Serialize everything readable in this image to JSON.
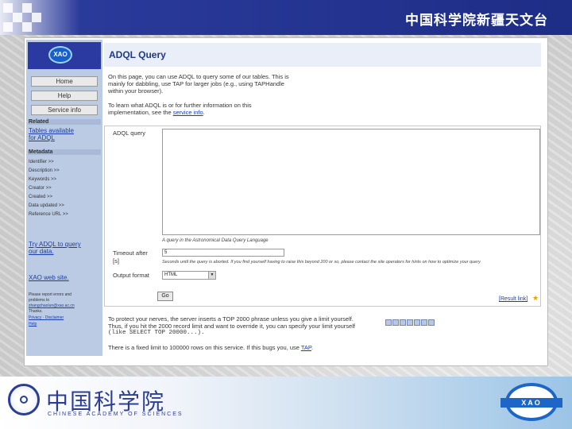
{
  "slide": {
    "title": "中国科学院新疆天文台"
  },
  "sidebar": {
    "logo_text": "XAO",
    "nav": [
      "Home",
      "Help",
      "Service info"
    ],
    "related_heading": "Related",
    "tables_link": "Tables available for ADQL",
    "metadata_heading": "Metadata",
    "metadata_items": [
      "Identifier >>",
      "Description >>",
      "Keywords >>",
      "Creator >>",
      "Created >>",
      "Data updated >>",
      "Reference URL >>"
    ],
    "try_link": "Try ADQL to query our data.",
    "xao_link": "XAO web site.",
    "note_lines": [
      "Please report errors and problems to",
      "zhangchaolun@xao.ac.cn",
      "Thanks.",
      "Privacy · Disclaimer",
      "Help"
    ]
  },
  "main": {
    "title": "ADQL Query",
    "intro_line1": "On this page, you can use ADQL to query some of our tables. This is",
    "intro_line2": "mainly for dabbling, use TAP for larger jobs (e.g., using TAPHandle",
    "intro_line3": "within your browser).",
    "info_line1": "To learn what ADQL is or for further information on this",
    "info_line2_prefix": "implementation, see the",
    "info_link": "service info",
    "form": {
      "query_label": "ADQL query",
      "query_hint": "A query in the Astronomical Data Query Language",
      "timeout_label_1": "Timeout after",
      "timeout_label_2": "[s]",
      "timeout_value": "5",
      "timeout_hint": "Seconds until the query is aborted. If you find yourself having to raise this beyond 200 or so, please contact the site operators for hints on how to optimize your query",
      "format_label": "Output format",
      "format_value": "HTML",
      "go_label": "Go",
      "result_link": "[Result link]"
    },
    "footer_line1": "To protect your nerves, the server inserts a TOP 2000 phrase unless you give a limit yourself.",
    "footer_line2": "Thus, if you hit the 2000 record limit and want to override it, you can specify your limit yourself",
    "footer_line3": "(like SELECT TOP 20000...).",
    "footer_line4_prefix": "There is a fixed limit to 100000 rows on this service. If this bugs you, use",
    "footer_tap_link": "TAP"
  },
  "banner": {
    "cas_chinese": "中国科学院",
    "cas_english": "CHINESE ACADEMY OF SCIENCES",
    "xao_text": "XAO"
  },
  "colors": {
    "header_blue": "#1e2d86",
    "sidebar_blue": "#bccbe4",
    "link_blue": "#1a3ea8"
  }
}
